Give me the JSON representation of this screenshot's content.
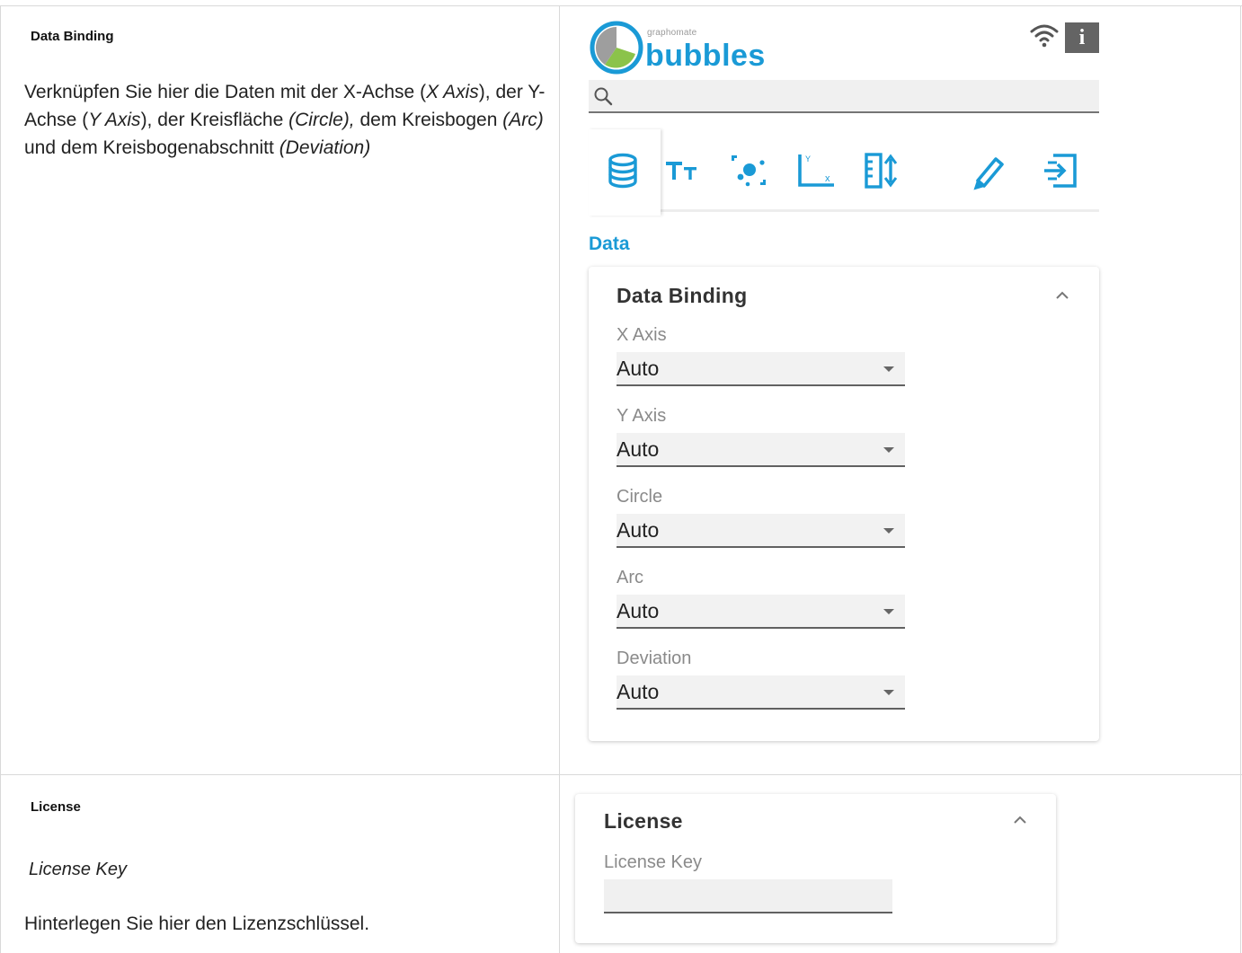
{
  "row1": {
    "title": "Data Binding",
    "description_parts": [
      {
        "text": "Verknüpfen Sie hier die Daten mit der X-Achse (",
        "italic": false
      },
      {
        "text": "X Axis",
        "italic": true
      },
      {
        "text": "), der Y-Achse (",
        "italic": false
      },
      {
        "text": "Y Axis",
        "italic": true
      },
      {
        "text": "), der Kreisfläche ",
        "italic": false
      },
      {
        "text": "(Circle),",
        "italic": true
      },
      {
        "text": " dem Kreisbogen ",
        "italic": false
      },
      {
        "text": "(Arc)",
        "italic": true
      },
      {
        "text": " und dem Kreisbogenabschnitt ",
        "italic": false
      },
      {
        "text": "(Deviation)",
        "italic": true
      }
    ]
  },
  "logo": {
    "small": "graphomate",
    "big": "bubbles",
    "pie_colors": [
      "#1a9ad6",
      "#9e9e9e",
      "#8bc34a"
    ]
  },
  "header_icons": {
    "wifi": "wifi-icon",
    "info": "i"
  },
  "search": {
    "icon": "search-icon",
    "value": ""
  },
  "tabs": [
    {
      "name": "database-icon",
      "active": true
    },
    {
      "name": "text-size-icon",
      "active": false
    },
    {
      "name": "bubbles-scatter-icon",
      "active": false
    },
    {
      "name": "axis-icon",
      "active": false
    },
    {
      "name": "scale-icon",
      "active": false
    },
    {
      "name": "pen-icon",
      "active": false
    },
    {
      "name": "export-icon",
      "active": false
    }
  ],
  "accent_color": "#1a9ad6",
  "data_section": {
    "title": "Data",
    "card_title": "Data Binding",
    "fields": [
      {
        "label": "X Axis",
        "value": "Auto"
      },
      {
        "label": "Y Axis",
        "value": "Auto"
      },
      {
        "label": "Circle",
        "value": "Auto"
      },
      {
        "label": "Arc",
        "value": "Auto"
      },
      {
        "label": "Deviation",
        "value": "Auto"
      }
    ]
  },
  "row2": {
    "title": "License",
    "sublabel": "License Key",
    "description": "Hinterlegen Sie hier den Lizenzschlüssel."
  },
  "license_card": {
    "title": "License",
    "field_label": "License Key",
    "field_value": ""
  }
}
